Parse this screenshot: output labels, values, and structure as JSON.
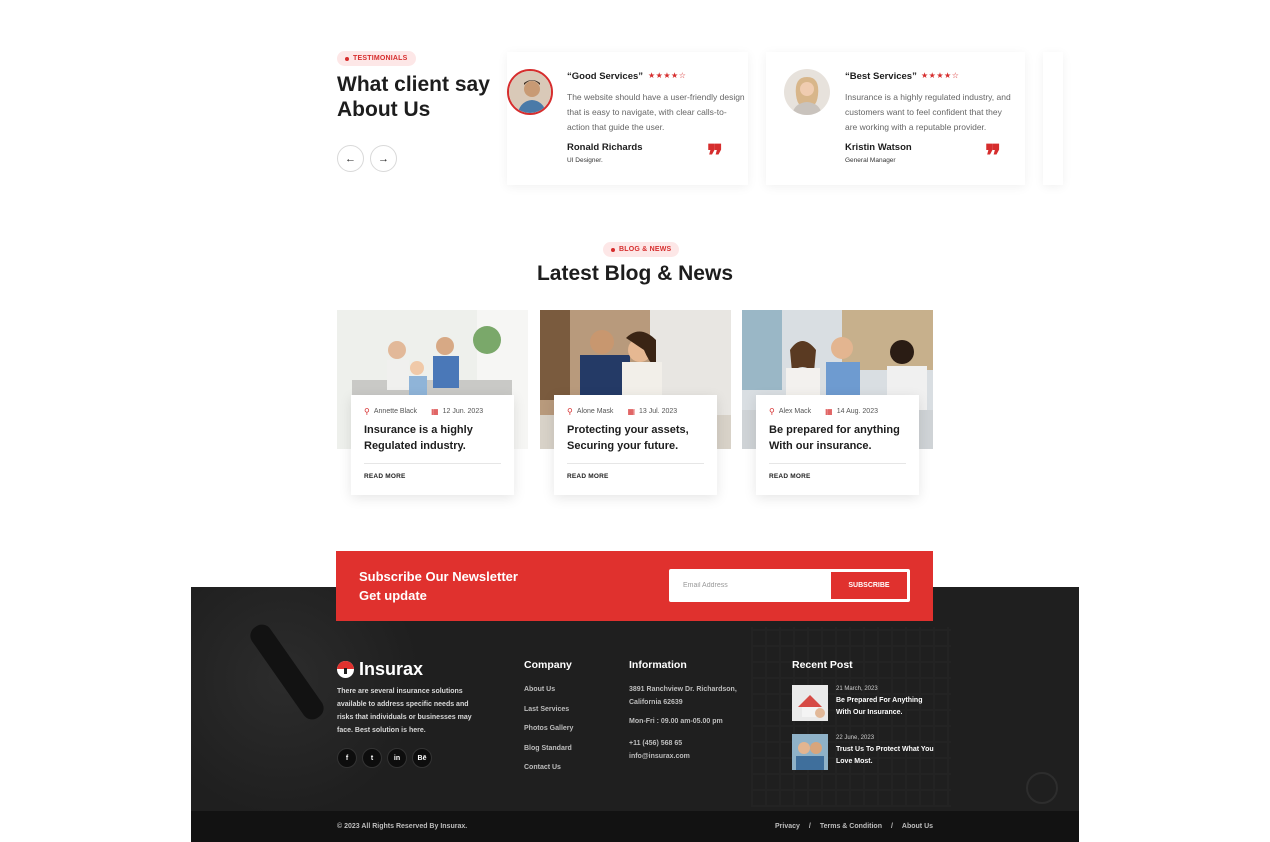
{
  "testimonials": {
    "badge": "TESTIMONIALS",
    "title": "What client say About Us",
    "cards": [
      {
        "quote_title": "“Good Services”",
        "stars": "★★★★☆",
        "text": "The website should have a user-friendly design that is easy to navigate, with clear calls-to-action that guide the user.",
        "name": "Ronald Richards",
        "role": "UI Designer."
      },
      {
        "quote_title": "“Best Services”",
        "stars": "★★★★☆",
        "text": "Insurance is a highly regulated industry, and customers want to feel confident that they are working with a reputable provider.",
        "name": "Kristin Watson",
        "role": "General Manager"
      }
    ],
    "quote_mark": "❞",
    "prev_icon": "←",
    "next_icon": "→"
  },
  "blog": {
    "badge": "BLOG & NEWS",
    "title": "Latest Blog & News",
    "posts": [
      {
        "author": "Annette Black",
        "date": "12 Jun. 2023",
        "title": "Insurance is a highly Regulated industry.",
        "more": "READ MORE"
      },
      {
        "author": "Alone Mask",
        "date": "13 Jul. 2023",
        "title": "Protecting your assets, Securing your future.",
        "more": "READ MORE"
      },
      {
        "author": "Alex Mack",
        "date": "14 Aug. 2023",
        "title": "Be prepared for anything With our insurance.",
        "more": "READ MORE"
      }
    ]
  },
  "newsletter": {
    "title_line1": "Subscribe Our Newsletter",
    "title_line2": "Get update",
    "placeholder": "Email Address",
    "button": "SUBSCRIBE"
  },
  "footer": {
    "brand": "Insurax",
    "description": "There are several insurance solutions available to address specific needs and risks that individuals or businesses may face. Best solution is here.",
    "socials": [
      "f",
      "t",
      "in",
      "Bē"
    ],
    "company_heading": "Company",
    "company_links": [
      "About Us",
      "Last Services",
      "Photos Gallery",
      "Blog Standard",
      "Contact Us"
    ],
    "info_heading": "Information",
    "address_line1": "3891 Ranchview Dr. Richardson,",
    "address_line2": "California 62639",
    "hours": "Mon-Fri : 09.00 am-05.00 pm",
    "phone": "+11 (456) 568 65",
    "email": "info@insurax.com",
    "recent_heading": "Recent Post",
    "recent": [
      {
        "date": "21 March, 2023",
        "title": "Be Prepared For Anything With Our Insurance."
      },
      {
        "date": "22 June, 2023",
        "title": "Trust Us To Protect What You Love Most."
      }
    ],
    "copyright": "© 2023 All Rights Reserved By Insurax.",
    "legal": [
      "Privacy",
      "/",
      "Terms & Condition",
      "/",
      "About Us"
    ]
  },
  "colors": {
    "accent": "#e0312e",
    "footer_bg": "#1f1f1f"
  }
}
